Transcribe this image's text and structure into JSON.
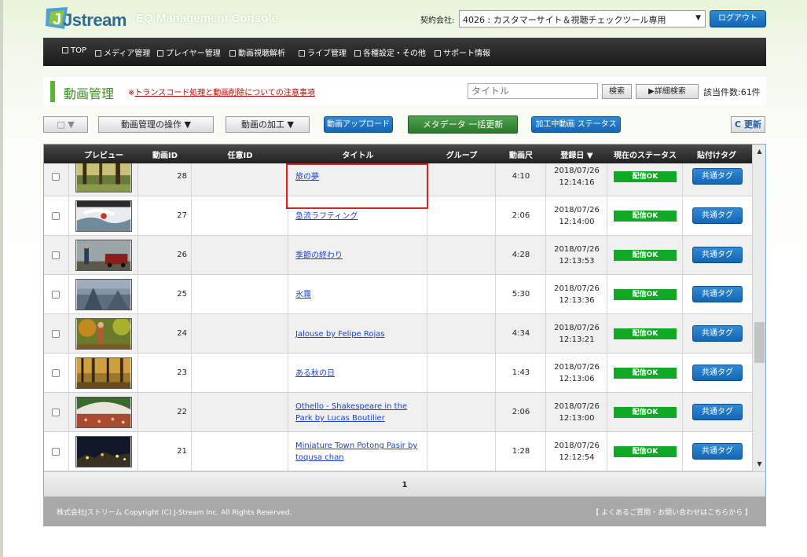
{
  "header": {
    "logo_text": "Jstream",
    "console_title": "EQ Management Console",
    "contract_label": "契約会社:",
    "contract_value": "4026 : カスタマーサイト＆視聴チェックツール専用",
    "logout_label": "ログアウト"
  },
  "nav": {
    "items": [
      {
        "label": "TOP"
      },
      {
        "label": "メディア管理"
      },
      {
        "label": "プレイヤー管理"
      },
      {
        "label": "動画視聴解析"
      },
      {
        "label": "ライブ管理"
      },
      {
        "label": "各種設定・その他"
      },
      {
        "label": "サポート情報"
      }
    ]
  },
  "page": {
    "title": "動画管理",
    "notice_prefix": "※",
    "notice_link": "トランスコード処理と動画削除についての注意事項",
    "search_placeholder": "タイトル",
    "search_label": "検索",
    "advanced_search_label": "▶詳細検索",
    "result_count": "該当件数:61件"
  },
  "toolbar": {
    "select_label": "□ ▼",
    "operations_label": "動画管理の操作 ▼",
    "processing_label": "動画の加工 ▼",
    "upload_label": "動画アップロード",
    "metadata_label": "メタデータ 一括更新",
    "status_label": "加工中動画 ステータス",
    "refresh_label": "C 更新"
  },
  "table": {
    "headers": [
      "プレビュー",
      "動画ID",
      "任意ID",
      "タイトル",
      "グループ",
      "動画尺",
      "登録日 ▼",
      "現在のステータス",
      "貼付けタグ"
    ],
    "rows": [
      {
        "id": "28",
        "title": "旅の夢",
        "duration": "4:10",
        "date": "2018/07/26",
        "time": "12:14:16",
        "status": "配信OK",
        "tag": "共通タグ",
        "thumb": "forest"
      },
      {
        "id": "27",
        "title": "急流ラフティング",
        "duration": "2:06",
        "date": "2018/07/26",
        "time": "12:14:00",
        "status": "配信OK",
        "tag": "共通タグ",
        "thumb": "rapids"
      },
      {
        "id": "26",
        "title": "季節の終わり",
        "duration": "4:28",
        "date": "2018/07/26",
        "time": "12:13:53",
        "status": "配信OK",
        "tag": "共通タグ",
        "thumb": "car"
      },
      {
        "id": "25",
        "title": "氷霧",
        "duration": "5:30",
        "date": "2018/07/26",
        "time": "12:13:36",
        "status": "配信OK",
        "tag": "共通タグ",
        "thumb": "fog"
      },
      {
        "id": "24",
        "title": "Jalouse by Felipe Rojas",
        "duration": "4:34",
        "date": "2018/07/26",
        "time": "12:13:21",
        "status": "配信OK",
        "tag": "共通タグ",
        "thumb": "autumn"
      },
      {
        "id": "23",
        "title": "ある秋の日",
        "duration": "1:43",
        "date": "2018/07/26",
        "time": "12:13:06",
        "status": "配信OK",
        "tag": "共通タグ",
        "thumb": "woods"
      },
      {
        "id": "22",
        "title": "Othello - Shakespeare in the Park by Lucas Boutilier",
        "duration": "2:06",
        "date": "2018/07/26",
        "time": "12:13:00",
        "status": "配信OK",
        "tag": "共通タグ",
        "thumb": "theater"
      },
      {
        "id": "21",
        "title": "Miniature Town Potong Pasir by toqusa chan",
        "duration": "1:28",
        "date": "2018/07/26",
        "time": "12:12:54",
        "status": "配信OK",
        "tag": "共通タグ",
        "thumb": "night"
      }
    ],
    "page_number": "1"
  },
  "footer": {
    "copyright": "株式会社Jストリーム  Copyright (C) J-Stream Inc. All Rights Reserved.",
    "help": "【 よくあるご質問・お問い合わせはこちらから 】"
  },
  "colors": {
    "accent_green": "#5cb531",
    "status_green": "#11a826",
    "button_blue": "#1a73c4",
    "highlight_red": "#e02020"
  }
}
